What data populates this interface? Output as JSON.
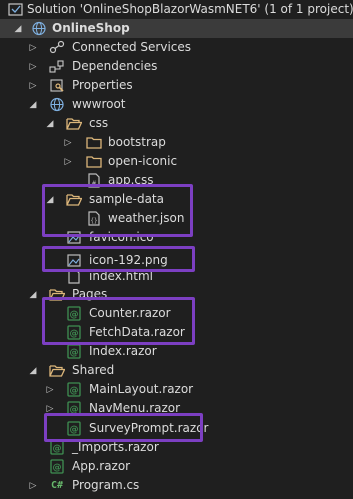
{
  "solution": {
    "label": "Solution 'OnlineShopBlazorWasmNET6' (1 of 1 project)",
    "icon": "solution-icon"
  },
  "project": {
    "label": "OnlineShop",
    "icon": "project-globe-icon"
  },
  "items": {
    "connected_services": "Connected Services",
    "dependencies": "Dependencies",
    "properties": "Properties",
    "wwwroot": "wwwroot",
    "css": "css",
    "bootstrap": "bootstrap",
    "open_iconic": "open-iconic",
    "app_css": "app.css",
    "sample_data": "sample-data",
    "weather_json": "weather.json",
    "favicon": "favicon.ico",
    "icon_192": "icon-192.png",
    "index_html": "index.html",
    "pages": "Pages",
    "counter": "Counter.razor",
    "fetchdata": "FetchData.razor",
    "index_razor": "Index.razor",
    "shared": "Shared",
    "mainlayout": "MainLayout.razor",
    "navmenu": "NavMenu.razor",
    "surveyprompt": "SurveyPrompt.razor",
    "imports": "_Imports.razor",
    "app_razor": "App.razor",
    "program_cs": "Program.cs"
  },
  "colors": {
    "background": "#1f1f1f",
    "text": "#dcdcdc",
    "folder": "#dcb67a",
    "razor": "#3f8f52",
    "highlight": "#7c3fc2"
  }
}
